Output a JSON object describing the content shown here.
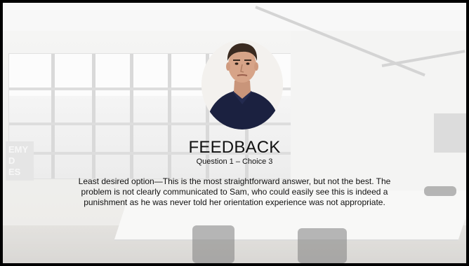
{
  "slide": {
    "title": "FEEDBACK",
    "subtitle": "Question 1 – Choice 3",
    "body": "Least desired option—This is the most straightforward answer, but not the best. The problem is not clearly communicated to Sam, who could easily see this is indeed a punishment as he was never told her orientation experience was not appropriate."
  },
  "background": {
    "poster_text": [
      "EMY",
      "D",
      "ES"
    ]
  }
}
